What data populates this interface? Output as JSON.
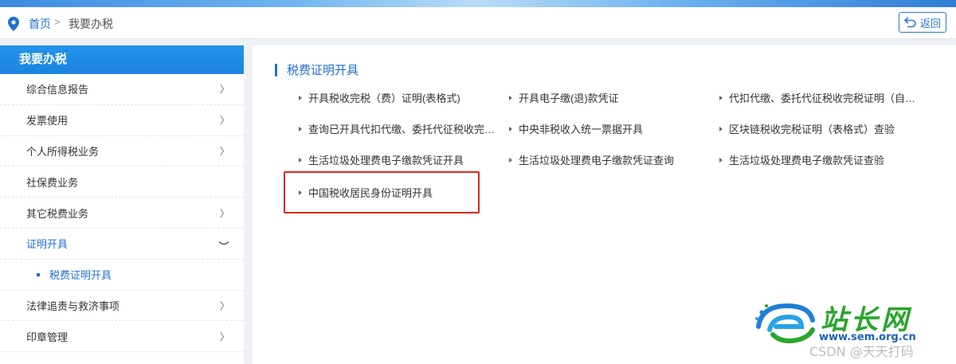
{
  "breadcrumb": {
    "home": "首页",
    "separator": ">",
    "current": "我要办税"
  },
  "back_button": {
    "label": "返回"
  },
  "sidebar": {
    "title": "我要办税",
    "items": [
      {
        "label": "综合信息报告",
        "chevron": "〉"
      },
      {
        "label": "发票使用",
        "chevron": "〉"
      },
      {
        "label": "个人所得税业务",
        "chevron": "〉"
      },
      {
        "label": "社保费业务",
        "chevron": ""
      },
      {
        "label": "其它税费业务",
        "chevron": "〉"
      },
      {
        "label": "证明开具",
        "expanded": true
      },
      {
        "label": "法律追责与救济事项",
        "chevron": "〉"
      },
      {
        "label": "印章管理",
        "chevron": "〉"
      }
    ],
    "subitem": {
      "label": "税费证明开具"
    }
  },
  "main": {
    "section_title": "税费证明开具",
    "links": [
      "开具税收完税（费）证明(表格式)",
      "开具电子缴(退)款凭证",
      "代扣代缴、委托代征税收完税证明（自…",
      "查询已开具代扣代缴、委托代征税收完…",
      "中央非税收入统一票据开具",
      "区块链税收完税证明（表格式）查验",
      "生活垃圾处理费电子缴款凭证开具",
      "生活垃圾处理费电子缴款凭证查询",
      "生活垃圾处理费电子缴款凭证查验",
      "中国税收居民身份证明开具"
    ]
  },
  "watermark": {
    "brand": "站长网",
    "url": "www.sem.org.cn",
    "csdn": "CSDN @天天打码"
  },
  "colors": {
    "accent": "#1f6fd1",
    "sidebar_header": "#1e88e5",
    "highlight": "#e0231a",
    "brand_green": "#2aa52e"
  }
}
